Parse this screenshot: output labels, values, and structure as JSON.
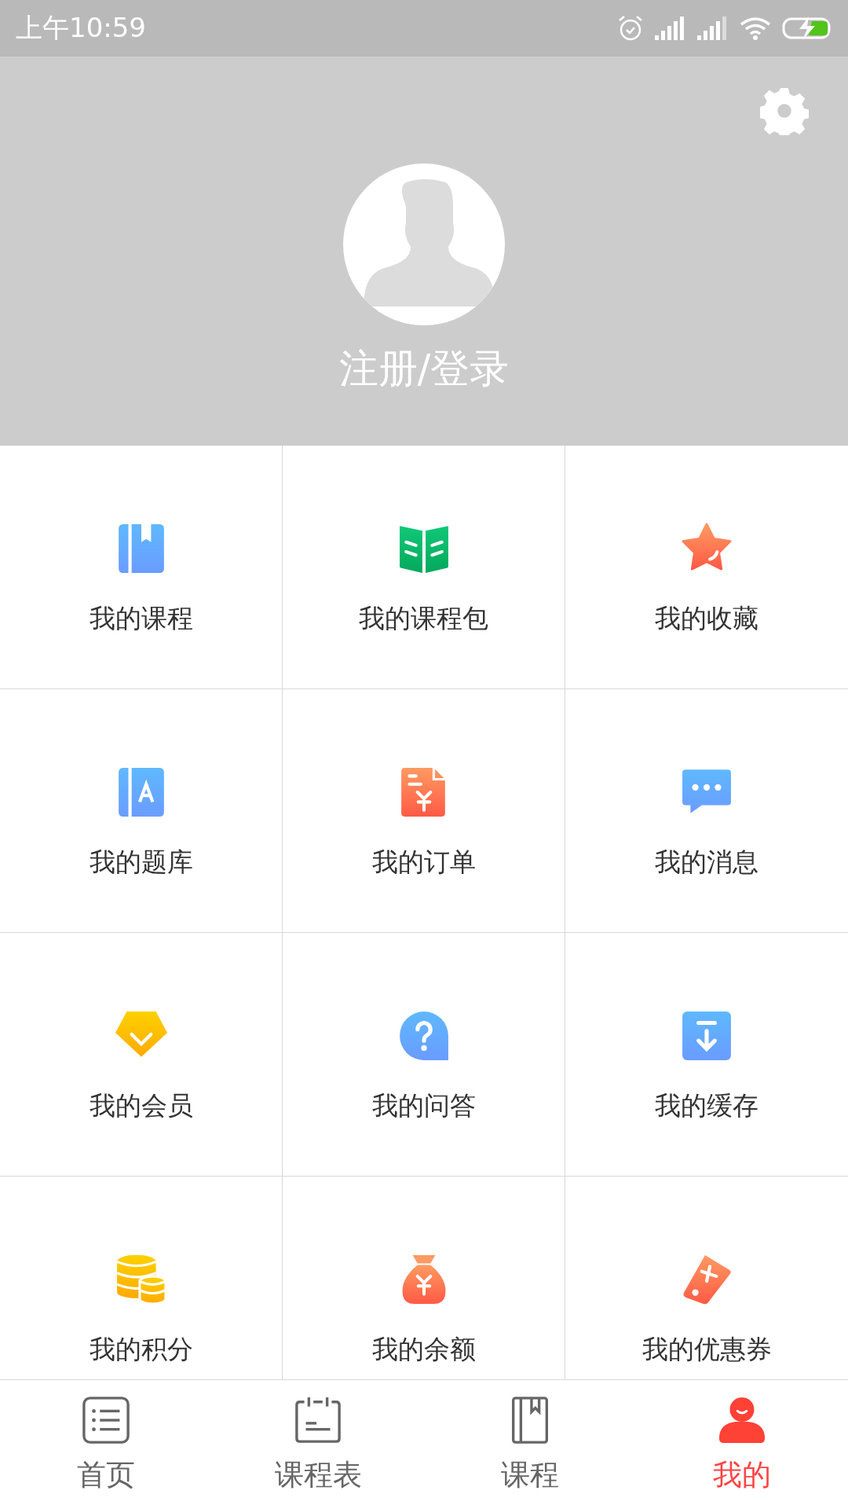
{
  "status_bar": {
    "time": "上午10:59"
  },
  "profile": {
    "login_label": "注册/登录"
  },
  "menu_grid": [
    {
      "label": "我的课程"
    },
    {
      "label": "我的课程包"
    },
    {
      "label": "我的收藏"
    },
    {
      "label": "我的题库"
    },
    {
      "label": "我的订单"
    },
    {
      "label": "我的消息"
    },
    {
      "label": "我的会员"
    },
    {
      "label": "我的问答"
    },
    {
      "label": "我的缓存"
    },
    {
      "label": "我的积分"
    },
    {
      "label": "我的余额"
    },
    {
      "label": "我的优惠券"
    }
  ],
  "tab_bar": [
    {
      "label": "首页",
      "selected": false
    },
    {
      "label": "课程表",
      "selected": false
    },
    {
      "label": "课程",
      "selected": false
    },
    {
      "label": "我的",
      "selected": true
    }
  ]
}
